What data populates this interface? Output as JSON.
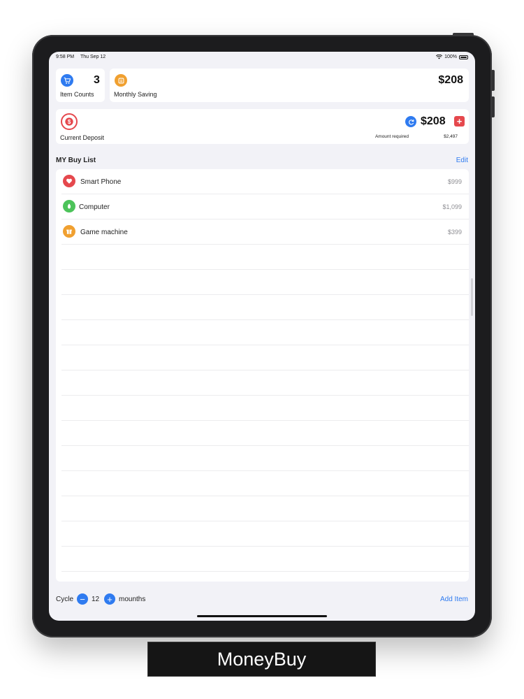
{
  "status_bar": {
    "time": "9:58 PM",
    "date": "Thu Sep 12",
    "battery": "100%"
  },
  "summary": {
    "item_counts": {
      "value": "3",
      "label": "Item Counts",
      "icon": "cart-icon",
      "color": "#2f7bf0"
    },
    "monthly_saving": {
      "value": "$208",
      "label": "Monthly Saving",
      "icon": "calendar-icon",
      "color": "#f0a030"
    },
    "current_deposit": {
      "value": "$208",
      "label": "Current Deposit",
      "icon": "dollar-icon",
      "color": "#e5484d",
      "amount_required_label": "Amount required",
      "amount_required_value": "$2,497"
    }
  },
  "buy_list": {
    "title": "MY Buy List",
    "edit_label": "Edit",
    "items": [
      {
        "name": "Smart Phone",
        "price": "$999",
        "icon": "heart-icon",
        "color": "#e5484d"
      },
      {
        "name": "Computer",
        "price": "$1,099",
        "icon": "leaf-icon",
        "color": "#4cc35a"
      },
      {
        "name": "Game machine",
        "price": "$399",
        "icon": "gift-icon",
        "color": "#f0a030"
      }
    ]
  },
  "footer": {
    "cycle_label": "Cycle",
    "cycle_value": "12",
    "unit_label": "mounths",
    "add_label": "Add Item"
  },
  "brand": {
    "name": "MoneyBuy"
  }
}
